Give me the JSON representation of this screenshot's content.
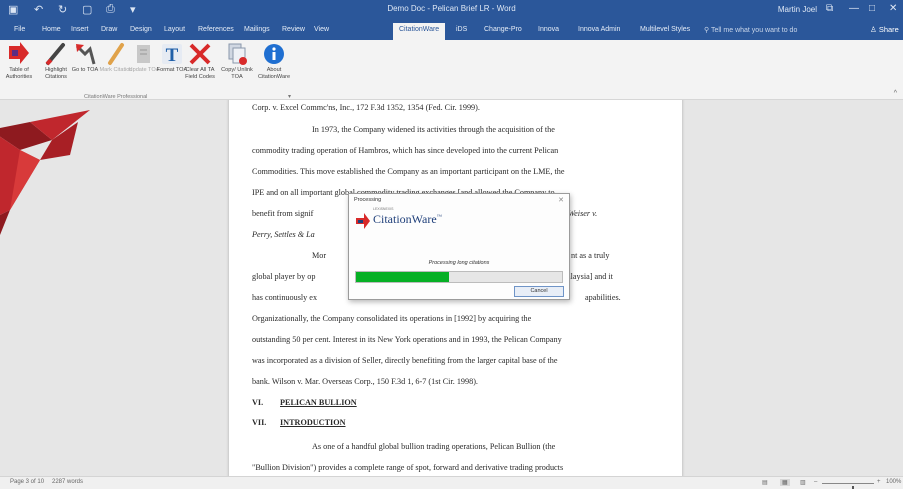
{
  "window": {
    "title": "Demo Doc - Pelican Brief LR - Word",
    "user": "Martin Joel",
    "buttons": {
      "ribbon_display": "⧉",
      "minimize": "—",
      "maximize": "□",
      "close": "✕"
    }
  },
  "quick_access": {
    "save": "▣",
    "undo": "↶",
    "redo": "↻",
    "new": "▢",
    "print": "⎙",
    "customize": "▾"
  },
  "tabs": [
    {
      "label": "File"
    },
    {
      "label": "Home"
    },
    {
      "label": "Insert"
    },
    {
      "label": "Draw"
    },
    {
      "label": "Design"
    },
    {
      "label": "Layout"
    },
    {
      "label": "References"
    },
    {
      "label": "Mailings"
    },
    {
      "label": "Review"
    },
    {
      "label": "View"
    },
    {
      "label": "CitationWare"
    },
    {
      "label": "iDS"
    },
    {
      "label": "Change-Pro"
    },
    {
      "label": "Innova"
    },
    {
      "label": "Innova Admin"
    },
    {
      "label": "Multilevel Styles"
    }
  ],
  "active_tab_index": 10,
  "tell_me": "Tell me what you want to do",
  "share": "Share",
  "ribbon": {
    "buttons": [
      {
        "label": "Table of Authorities",
        "icon": "table-of-authorities-icon",
        "enabled": true
      },
      {
        "label": "Highlight Citations",
        "icon": "highlight-pen-icon",
        "enabled": true
      },
      {
        "label": "Go to TOA",
        "icon": "go-to-toa-icon",
        "enabled": true
      },
      {
        "label": "Mark Citation",
        "icon": "mark-citation-icon",
        "enabled": false
      },
      {
        "label": "Update TOA",
        "icon": "update-toa-icon",
        "enabled": false
      },
      {
        "label": "Format TOA",
        "icon": "format-toa-icon",
        "enabled": true
      },
      {
        "label": "Clear All TA Field Codes",
        "icon": "clear-codes-icon",
        "enabled": true
      },
      {
        "label": "Copy/ Unlink TOA",
        "icon": "copy-unlink-icon",
        "enabled": true
      },
      {
        "label": "About CitationWare",
        "icon": "info-icon",
        "enabled": true
      }
    ],
    "group_label": "CitationWare Professional",
    "group_expander": "▾",
    "collapse": "^"
  },
  "document": {
    "lines": [
      "Corp. v. Excel Commc'ns, Inc., 172 F.3d 1352, 1354 (Fed. Cir. 1999).",
      "In 1973, the Company widened its activities through the acquisition of the",
      "commodity trading operation of Hambros, which has since developed into the current Pelican",
      "Commodities. This move established the Company as an important participant on the LME, the",
      "IPE and on all important global commodity trading exchanges [and allowed the Company to",
      "benefit from signif",
      ". Weiser v.",
      "Perry, Settles & La",
      "Mor",
      "nt as a truly",
      "global player by op",
      "alaysia] and it",
      "has continuously ex",
      "apabilities.",
      "Organizationally, the Company consolidated its operations in [1992] by acquiring the",
      "outstanding 50 per cent. Interest in its New York operations and in 1993, the Pelican Company",
      "was incorporated as a division of Seller, directly benefiting from the larger capital base of the",
      "bank. Wilson v. Mar. Overseas Corp., 150 F.3d 1, 6-7 (1st Cir. 1998)."
    ],
    "heading_vi": {
      "num": "VI.",
      "title": "PELICAN BULLION"
    },
    "heading_vii": {
      "num": "VII.",
      "title": "INTRODUCTION"
    },
    "lines_after": [
      "As one of a handful global bullion trading operations, Pelican Bullion (the",
      "\"Bullion Division\") provides a complete range of spot, forward and derivative trading products"
    ]
  },
  "dialog": {
    "title": "Processing",
    "close": "✕",
    "logo_small": "LEXISNEXIS",
    "logo_name": "CitationWare",
    "logo_mark": "™",
    "status": "Processing long citations",
    "progress_percent": 45,
    "cancel_label": "Cancel"
  },
  "statusbar": {
    "page": "Page 3 of 10",
    "words": "2287 words",
    "view_read": "▤",
    "view_print": "▦",
    "view_web": "▥",
    "zoom_minus": "–",
    "zoom_plus": "+",
    "zoom": "100%",
    "zoom_percent": 60
  },
  "colors": {
    "word_blue": "#2b579a",
    "ribbon_bg": "#f3f3f3",
    "progress_green": "#06b025",
    "bird_red": "#c0272d",
    "logo_red": "#d82a2a",
    "logo_blue": "#1f3f7a"
  }
}
